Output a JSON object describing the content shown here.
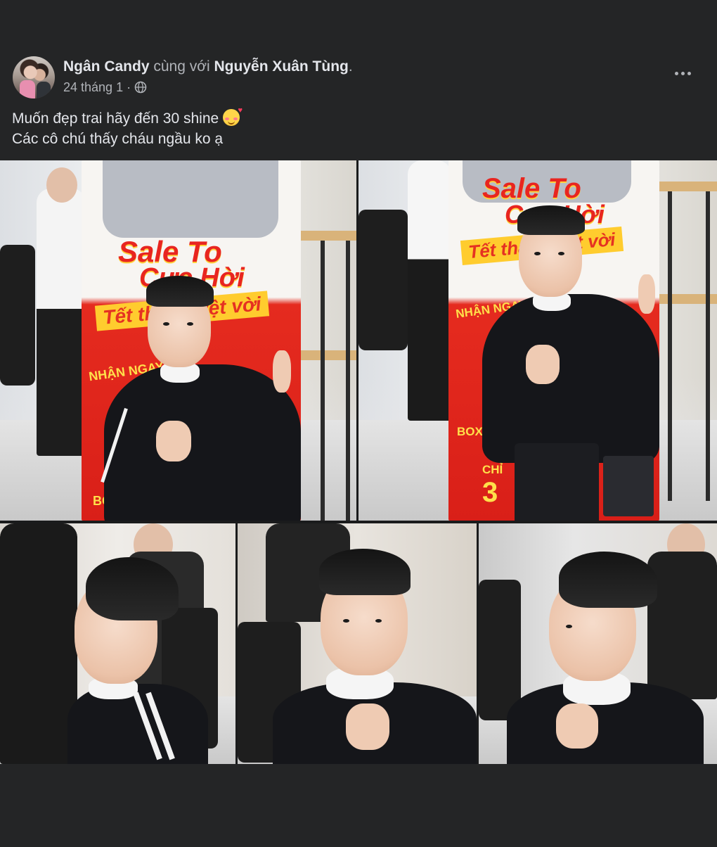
{
  "post": {
    "author": "Ngân Candy",
    "with_text": "cùng với",
    "tagged": "Nguyễn Xuân Tùng",
    "period": ".",
    "date": "24 tháng 1",
    "separator": "·",
    "privacy_icon": "globe-icon",
    "more_icon": "more-horizontal-icon"
  },
  "caption": {
    "line1": "Muốn đẹp trai hãy đến 30 shine",
    "line1_emoji": "smiling-face-with-hearts-emoji",
    "line2": "Các cô chú thấy cháu ngầu ko ạ"
  },
  "photos": {
    "photo1": {
      "banner_title_1": "Sale To",
      "banner_title_2": "Cực Hời",
      "banner_sub": "Tết thật tuyệt vời",
      "banner_text_1": "NHẬN NGAY",
      "banner_text_2": "BOX Đ"
    },
    "photo2": {
      "banner_title_1": "Sale To",
      "banner_title_2": "Cực Hời",
      "banner_sub": "Tết thật tuyệt vời",
      "banner_text_1": "NHẬN NGAY",
      "banner_text_2": "BOX Đ",
      "banner_text_3": "CHỈ",
      "banner_text_4": "3"
    }
  },
  "colors": {
    "background": "#242526",
    "primary_text": "#e4e6eb",
    "secondary_text": "#b0b3b8"
  }
}
